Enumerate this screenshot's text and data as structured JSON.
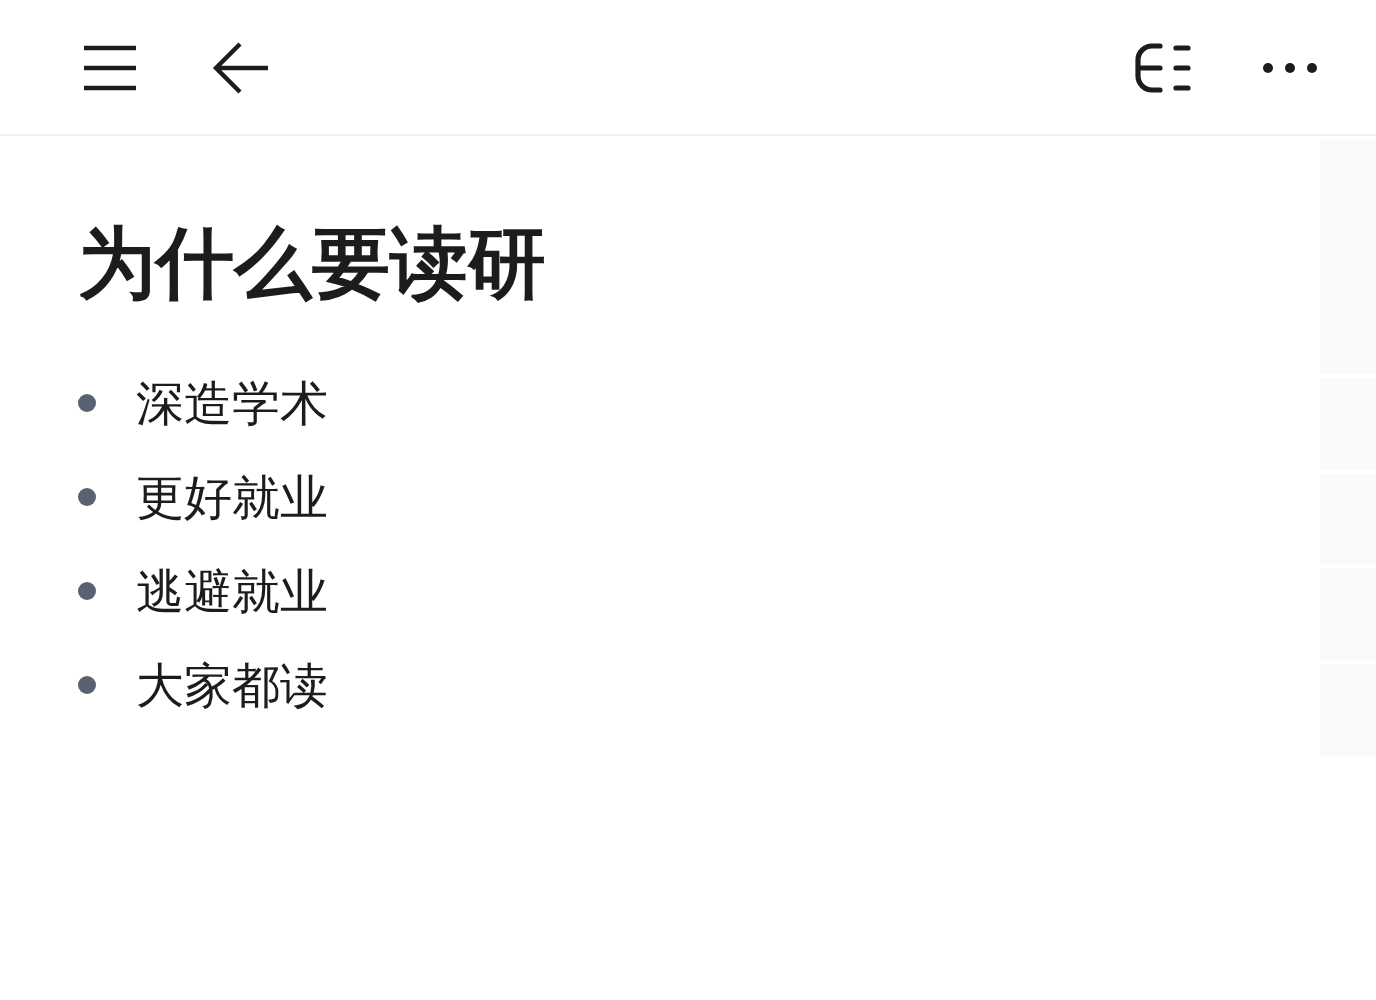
{
  "title": "为什么要读研",
  "bullets": [
    "深造学术",
    "更好就业",
    "逃避就业",
    "大家都读"
  ]
}
